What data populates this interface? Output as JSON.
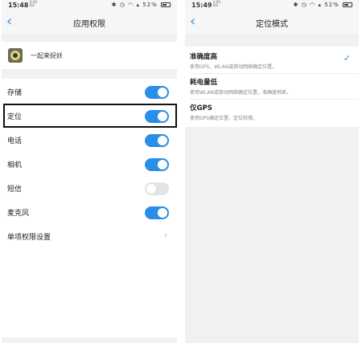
{
  "left_screen": {
    "status": {
      "time": "15:48",
      "tiny_top": "0.50",
      "tiny_bottom": "K/s",
      "battery": "52%"
    },
    "nav": {
      "back_glyph": "‹",
      "title": "应用权限"
    },
    "app": {
      "name": "一起来捉妖"
    },
    "permissions": [
      {
        "label": "存储",
        "control": "toggle",
        "state": "on"
      },
      {
        "label": "定位",
        "control": "toggle",
        "state": "on",
        "highlighted": true
      },
      {
        "label": "电话",
        "control": "toggle",
        "state": "on"
      },
      {
        "label": "相机",
        "control": "toggle",
        "state": "on"
      },
      {
        "label": "短信",
        "control": "toggle",
        "state": "off"
      },
      {
        "label": "麦克风",
        "control": "toggle",
        "state": "on"
      },
      {
        "label": "单项权限设置",
        "control": "chevron",
        "glyph": "›"
      }
    ]
  },
  "right_screen": {
    "status": {
      "time": "15:49",
      "tiny_top": "1.03",
      "tiny_bottom": "K/s",
      "battery": "52%"
    },
    "nav": {
      "back_glyph": "‹",
      "title": "定位模式"
    },
    "modes": [
      {
        "title": "准确度高",
        "desc": "使用GPS、WLAN或移动网络确定位置。",
        "selected": true
      },
      {
        "title": "耗电量低",
        "desc": "使用WLAN或移动网络确定位置，准确度稍差。",
        "selected": false
      },
      {
        "title": "仅GPS",
        "desc": "使用GPS确定位置，定位较慢。",
        "selected": false
      }
    ],
    "check_glyph": "✓"
  },
  "colors": {
    "accent": "#2a8ee8",
    "background": "#f1f1f3",
    "card": "#ffffff",
    "toggle_off": "#e4e4e6"
  },
  "icons": [
    "bluetooth-icon",
    "alarm-icon",
    "wifi-icon",
    "signal-icon",
    "battery-icon",
    "back-arrow-icon",
    "app-icon",
    "chevron-right-icon",
    "checkmark-icon"
  ]
}
